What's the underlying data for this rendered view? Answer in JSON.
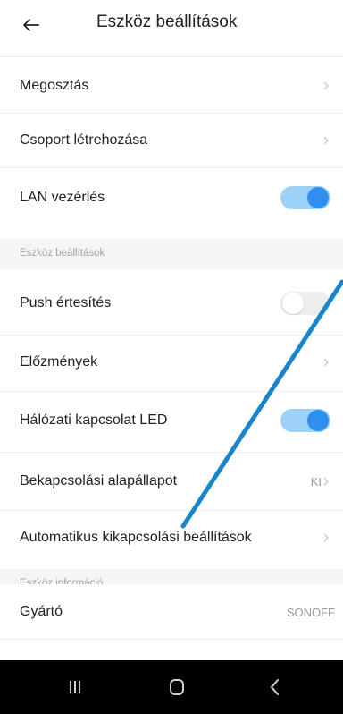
{
  "header": {
    "title": "Eszköz beállítások",
    "back_icon": "arrow-left-icon"
  },
  "rows_top": [
    {
      "label": "Megosztás",
      "control": "chevron"
    },
    {
      "label": "Csoport létrehozása",
      "control": "chevron"
    },
    {
      "label": "LAN vezérlés",
      "control": "toggle",
      "on": true
    }
  ],
  "section_device": {
    "title": "Eszköz beállítások"
  },
  "rows_device": [
    {
      "label": "Push értesítés",
      "control": "toggle",
      "on": false
    },
    {
      "label": "Előzmények",
      "control": "chevron"
    },
    {
      "label": "Hálózati kapcsolat LED",
      "control": "toggle",
      "on": true
    },
    {
      "label": "Bekapcsolási alapállapot",
      "control": "value-chevron",
      "value": "KI"
    },
    {
      "label": "Automatikus kikapcsolási beállítások",
      "control": "chevron"
    }
  ],
  "section_info": {
    "title": "Eszköz információ"
  },
  "rows_info": [
    {
      "label": "Gyártó",
      "value": "SONOFF"
    }
  ],
  "colors": {
    "accent": "#2f8fee",
    "toggle_track_on": "#9dd1f7",
    "annotation": "#1a86c9",
    "section_bg": "#f5f5f5"
  },
  "navbar": {
    "icons": [
      "recent-apps-icon",
      "home-icon",
      "back-icon"
    ]
  }
}
